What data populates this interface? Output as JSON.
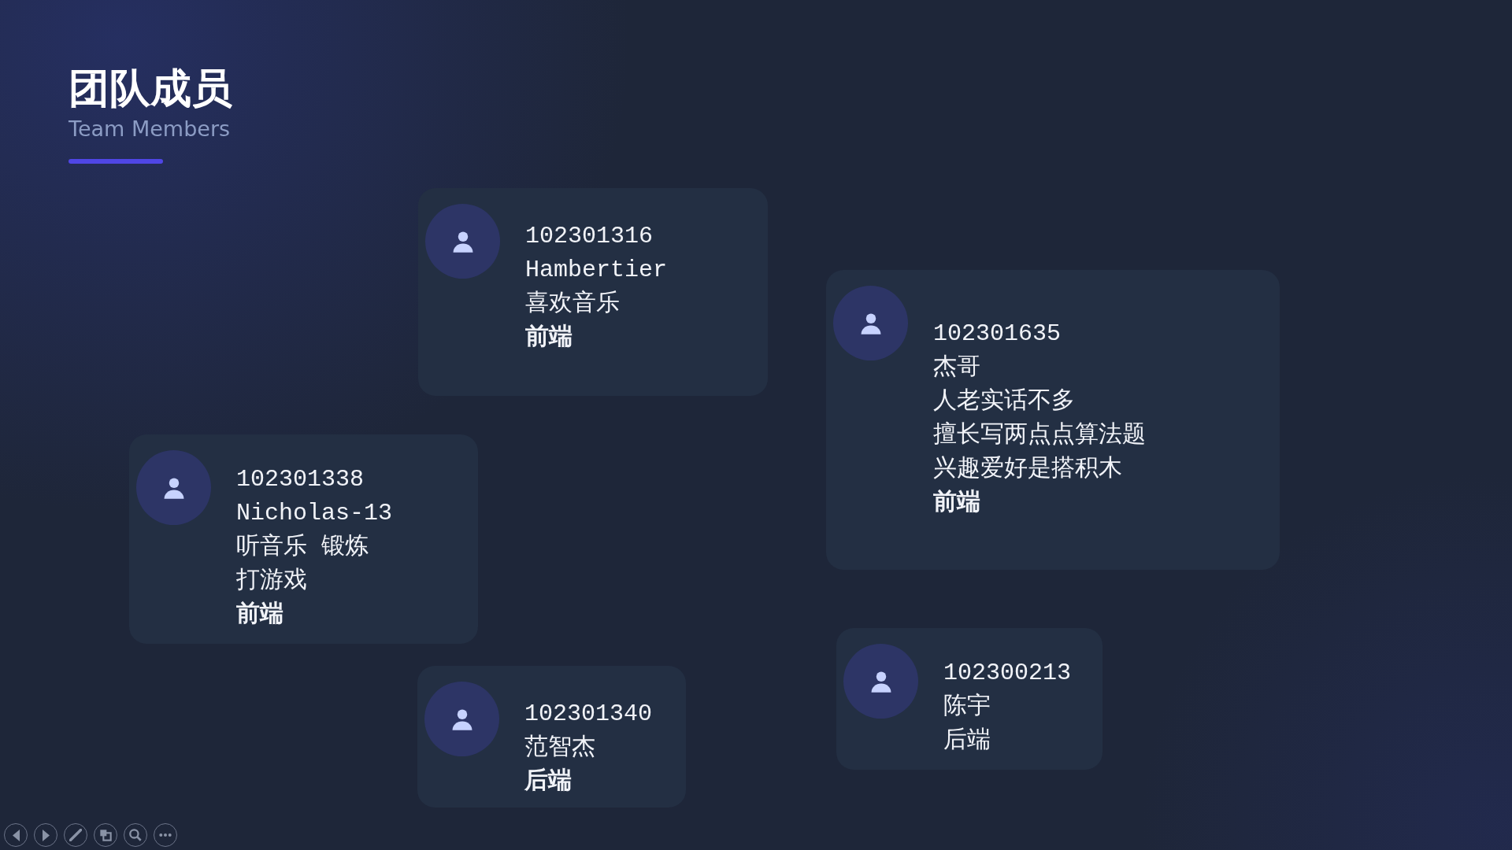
{
  "slide": {
    "title": "团队成员",
    "subtitle": "Team Members",
    "members": [
      {
        "lines": [
          {
            "text": "102301316",
            "bold": false
          },
          {
            "text": "Hambertier",
            "bold": false
          },
          {
            "text": "喜欢音乐",
            "bold": false
          },
          {
            "text": "前端",
            "bold": true
          }
        ]
      },
      {
        "lines": [
          {
            "text": "102301635",
            "bold": false
          },
          {
            "text": "杰哥",
            "bold": false
          },
          {
            "text": "人老实话不多",
            "bold": false
          },
          {
            "text": "擅长写两点点算法题",
            "bold": false
          },
          {
            "text": "兴趣爱好是搭积木",
            "bold": false
          },
          {
            "text": "前端",
            "bold": true
          }
        ]
      },
      {
        "lines": [
          {
            "text": "102301338",
            "bold": false
          },
          {
            "text": "Nicholas-13",
            "bold": false
          },
          {
            "text": "听音乐 锻炼",
            "bold": false
          },
          {
            "text": "打游戏",
            "bold": false
          },
          {
            "text": "前端",
            "bold": true
          }
        ]
      },
      {
        "lines": [
          {
            "text": "102301340",
            "bold": false
          },
          {
            "text": "范智杰",
            "bold": false
          },
          {
            "text": "后端",
            "bold": true
          }
        ]
      },
      {
        "lines": [
          {
            "text": "102300213",
            "bold": false
          },
          {
            "text": "陈宇",
            "bold": false
          },
          {
            "text": "后端",
            "bold": false
          }
        ]
      }
    ]
  },
  "slideshow_controls": [
    {
      "kind": "previous"
    },
    {
      "kind": "next"
    },
    {
      "kind": "pen"
    },
    {
      "kind": "slides"
    },
    {
      "kind": "zoom"
    },
    {
      "kind": "more"
    }
  ]
}
